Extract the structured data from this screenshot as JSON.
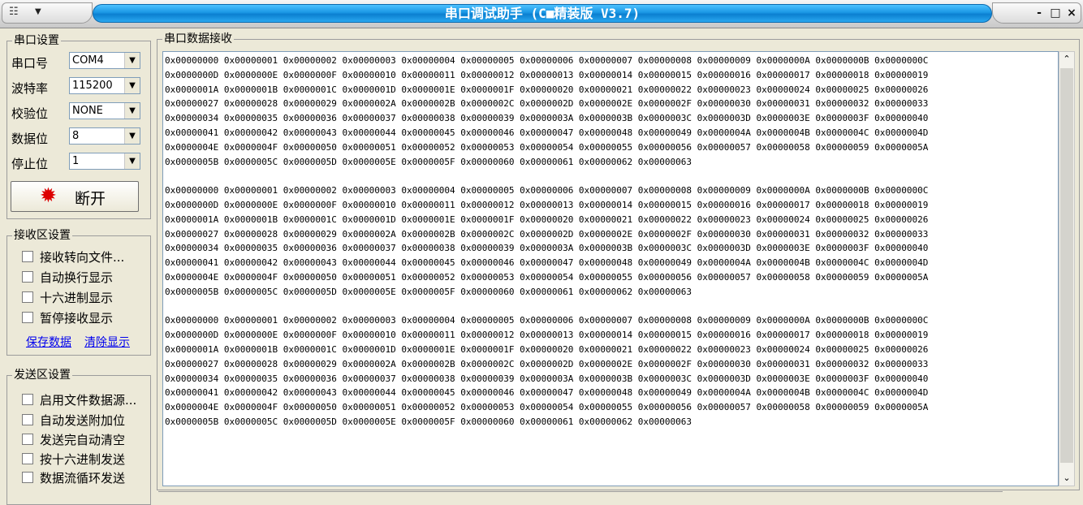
{
  "window": {
    "title": "串口调试助手 (C■精装版 V3.7)",
    "controls": [
      "-",
      "□",
      "×"
    ]
  },
  "serial_settings": {
    "group_title": "串口设置",
    "fields": [
      {
        "label": "串口号",
        "value": "COM4"
      },
      {
        "label": "波特率",
        "value": "115200"
      },
      {
        "label": "校验位",
        "value": "NONE"
      },
      {
        "label": "数据位",
        "value": "8"
      },
      {
        "label": "停止位",
        "value": "1"
      }
    ],
    "open_button_label": "断开"
  },
  "receive_settings": {
    "group_title": "接收区设置",
    "options": [
      "接收转向文件...",
      "自动换行显示",
      "十六进制显示",
      "暂停接收显示"
    ],
    "links": [
      "保存数据",
      "清除显示"
    ]
  },
  "send_settings": {
    "group_title": "发送区设置",
    "options": [
      "启用文件数据源...",
      "自动发送附加位",
      "发送完自动清空",
      "按十六进制发送",
      "数据流循环发送"
    ]
  },
  "receive_area": {
    "group_title": "串口数据接收",
    "lines": [
      "0x00000000 0x00000001 0x00000002 0x00000003 0x00000004 0x00000005 0x00000006 0x00000007 0x00000008 0x00000009 0x0000000A 0x0000000B 0x0000000C",
      "0x0000000D 0x0000000E 0x0000000F 0x00000010 0x00000011 0x00000012 0x00000013 0x00000014 0x00000015 0x00000016 0x00000017 0x00000018 0x00000019",
      "0x0000001A 0x0000001B 0x0000001C 0x0000001D 0x0000001E 0x0000001F 0x00000020 0x00000021 0x00000022 0x00000023 0x00000024 0x00000025 0x00000026",
      "0x00000027 0x00000028 0x00000029 0x0000002A 0x0000002B 0x0000002C 0x0000002D 0x0000002E 0x0000002F 0x00000030 0x00000031 0x00000032 0x00000033",
      "0x00000034 0x00000035 0x00000036 0x00000037 0x00000038 0x00000039 0x0000003A 0x0000003B 0x0000003C 0x0000003D 0x0000003E 0x0000003F 0x00000040",
      "0x00000041 0x00000042 0x00000043 0x00000044 0x00000045 0x00000046 0x00000047 0x00000048 0x00000049 0x0000004A 0x0000004B 0x0000004C 0x0000004D",
      "0x0000004E 0x0000004F 0x00000050 0x00000051 0x00000052 0x00000053 0x00000054 0x00000055 0x00000056 0x00000057 0x00000058 0x00000059 0x0000005A",
      "0x0000005B 0x0000005C 0x0000005D 0x0000005E 0x0000005F 0x00000060 0x00000061 0x00000062 0x00000063",
      "",
      "0x00000000 0x00000001 0x00000002 0x00000003 0x00000004 0x00000005 0x00000006 0x00000007 0x00000008 0x00000009 0x0000000A 0x0000000B 0x0000000C",
      "0x0000000D 0x0000000E 0x0000000F 0x00000010 0x00000011 0x00000012 0x00000013 0x00000014 0x00000015 0x00000016 0x00000017 0x00000018 0x00000019",
      "0x0000001A 0x0000001B 0x0000001C 0x0000001D 0x0000001E 0x0000001F 0x00000020 0x00000021 0x00000022 0x00000023 0x00000024 0x00000025 0x00000026",
      "0x00000027 0x00000028 0x00000029 0x0000002A 0x0000002B 0x0000002C 0x0000002D 0x0000002E 0x0000002F 0x00000030 0x00000031 0x00000032 0x00000033",
      "0x00000034 0x00000035 0x00000036 0x00000037 0x00000038 0x00000039 0x0000003A 0x0000003B 0x0000003C 0x0000003D 0x0000003E 0x0000003F 0x00000040",
      "0x00000041 0x00000042 0x00000043 0x00000044 0x00000045 0x00000046 0x00000047 0x00000048 0x00000049 0x0000004A 0x0000004B 0x0000004C 0x0000004D",
      "0x0000004E 0x0000004F 0x00000050 0x00000051 0x00000052 0x00000053 0x00000054 0x00000055 0x00000056 0x00000057 0x00000058 0x00000059 0x0000005A",
      "0x0000005B 0x0000005C 0x0000005D 0x0000005E 0x0000005F 0x00000060 0x00000061 0x00000062 0x00000063",
      "",
      "0x00000000 0x00000001 0x00000002 0x00000003 0x00000004 0x00000005 0x00000006 0x00000007 0x00000008 0x00000009 0x0000000A 0x0000000B 0x0000000C",
      "0x0000000D 0x0000000E 0x0000000F 0x00000010 0x00000011 0x00000012 0x00000013 0x00000014 0x00000015 0x00000016 0x00000017 0x00000018 0x00000019",
      "0x0000001A 0x0000001B 0x0000001C 0x0000001D 0x0000001E 0x0000001F 0x00000020 0x00000021 0x00000022 0x00000023 0x00000024 0x00000025 0x00000026",
      "0x00000027 0x00000028 0x00000029 0x0000002A 0x0000002B 0x0000002C 0x0000002D 0x0000002E 0x0000002F 0x00000030 0x00000031 0x00000032 0x00000033",
      "0x00000034 0x00000035 0x00000036 0x00000037 0x00000038 0x00000039 0x0000003A 0x0000003B 0x0000003C 0x0000003D 0x0000003E 0x0000003F 0x00000040",
      "0x00000041 0x00000042 0x00000043 0x00000044 0x00000045 0x00000046 0x00000047 0x00000048 0x00000049 0x0000004A 0x0000004B 0x0000004C 0x0000004D",
      "0x0000004E 0x0000004F 0x00000050 0x00000051 0x00000052 0x00000053 0x00000054 0x00000055 0x00000056 0x00000057 0x00000058 0x00000059 0x0000005A",
      "0x0000005B 0x0000005C 0x0000005D 0x0000005E 0x0000005F 0x00000060 0x00000061 0x00000062 0x00000063"
    ]
  },
  "icons": {
    "system_menu": "window-icon",
    "open_button": "red-led-icon"
  },
  "colors": {
    "title_bar_accent": "#1a97e4",
    "led_red": "#ff1a1a",
    "link_blue": "#0000ee"
  }
}
